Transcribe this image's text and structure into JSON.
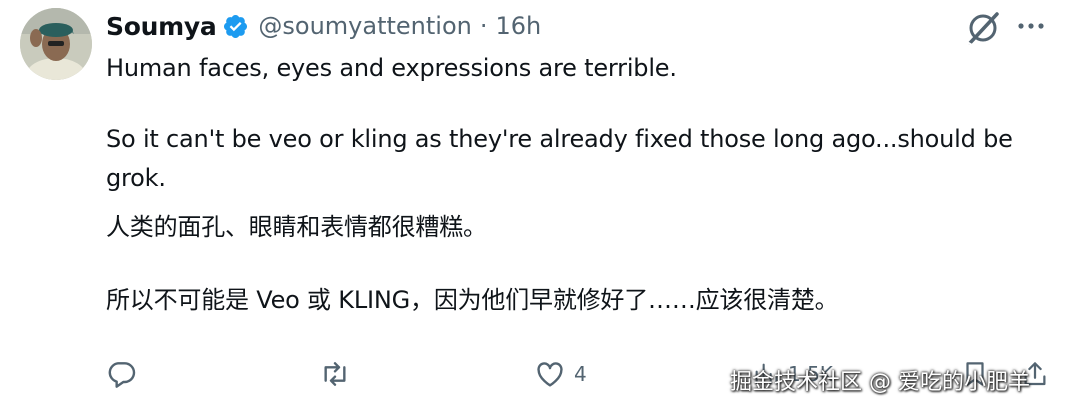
{
  "user": {
    "name": "Soumya",
    "handle": "@soumyattention",
    "separator": "·",
    "time": "16h"
  },
  "tweet": {
    "p1": "Human faces, eyes and expressions are terrible.",
    "p2_line1": "So it can't be veo or kling as they're already fixed those long ago...should be",
    "p2_line2": "grok.",
    "t1": "人类的面孔、眼睛和表情都很糟糕。",
    "t2": "所以不可能是 Veo 或 KLING，因为他们早就修好了……应该很清楚。"
  },
  "actions": {
    "reply_count": "",
    "retweet_count": "",
    "like_count": "4",
    "views_count": "1.5K"
  },
  "watermark": "掘金技术社区 @ 爱吃的小肥羊",
  "icons": {
    "verified": "verified-badge-icon",
    "grok": "grok-icon",
    "more": "more-icon",
    "reply": "reply-icon",
    "retweet": "retweet-icon",
    "like": "like-icon",
    "views": "views-icon",
    "bookmark": "bookmark-icon",
    "share": "share-icon"
  },
  "colors": {
    "text": "#0f1419",
    "secondary": "#536471",
    "verified": "#1d9bf0"
  }
}
